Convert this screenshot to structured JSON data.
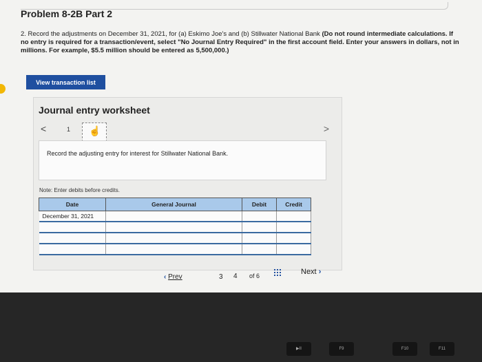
{
  "problem_title": "Problem 8-2B Part 2",
  "instructions": {
    "normal": "2. Record the adjustments on December 31, 2021, for (a) Eskimo Joe's and (b) Stillwater National Bank",
    "bold": "(Do not round intermediate calculations. If no entry is required for a transaction/event, select \"No Journal Entry Required\" in the first account field. Enter your answers in dollars, not in millions. For example, $5.5 million should be entered as 5,500,000.)"
  },
  "view_transaction_label": "View transaction list",
  "worksheet": {
    "title": "Journal entry worksheet",
    "nav_prev": "<",
    "current_num": "1",
    "nav_next": ">",
    "entry_prompt": "Record the adjusting entry for interest for Stillwater National Bank.",
    "note": "Note: Enter debits before credits.",
    "headers": [
      "Date",
      "General Journal",
      "Debit",
      "Credit"
    ],
    "rows": [
      [
        "December 31, 2021",
        "",
        "",
        ""
      ],
      [
        "",
        "",
        "",
        ""
      ],
      [
        "",
        "",
        "",
        ""
      ],
      [
        "",
        "",
        "",
        ""
      ]
    ]
  },
  "pager": {
    "prev_label": "Prev",
    "pages": [
      "3",
      "4"
    ],
    "of_label": "of 6",
    "next_label": "Next"
  },
  "keys": [
    "F9",
    "F10",
    "F11"
  ]
}
